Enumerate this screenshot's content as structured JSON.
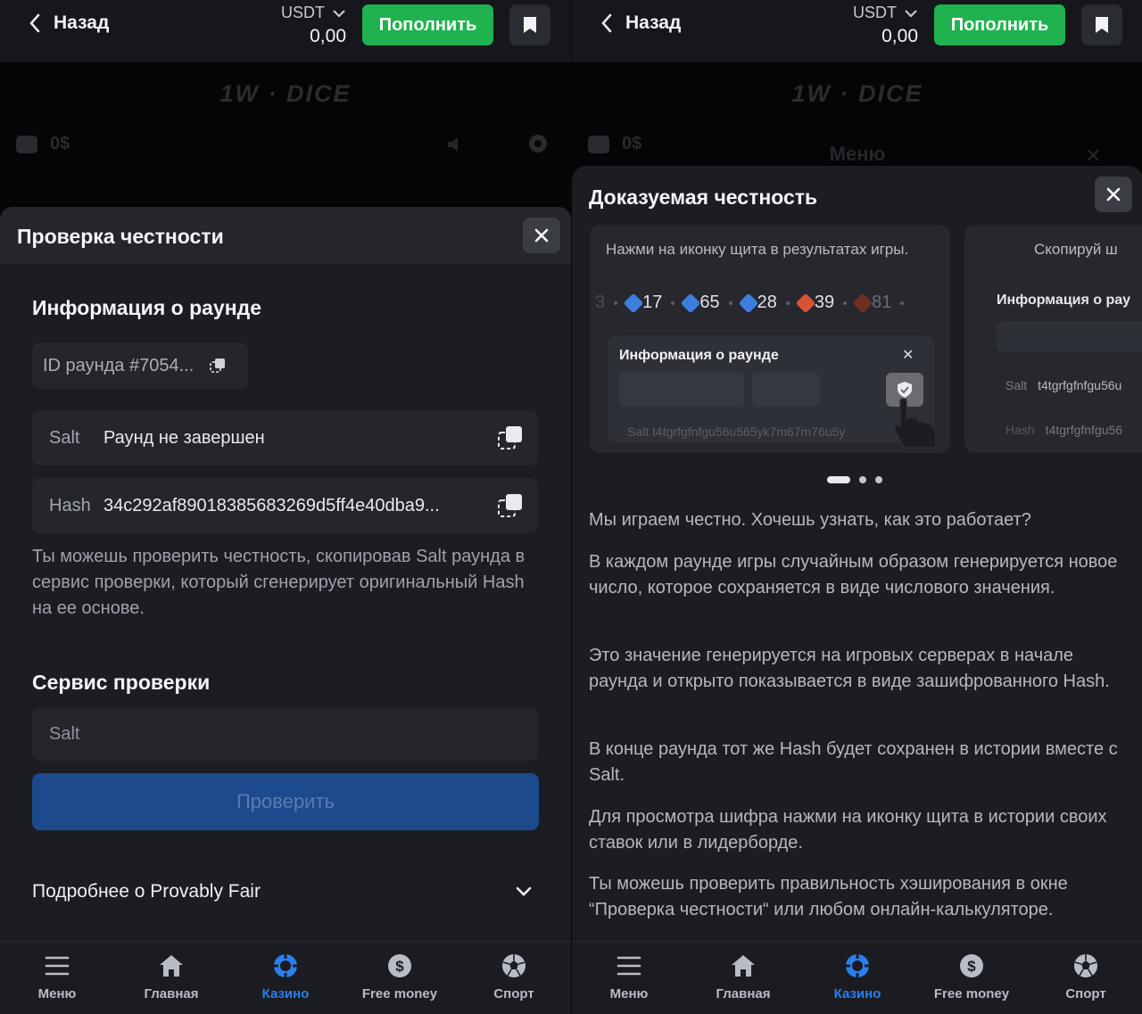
{
  "topbar": {
    "back_label": "Назад",
    "currency": "USDT",
    "balance": "0,00",
    "deposit_label": "Пополнить"
  },
  "game": {
    "logo": "1W · DICE",
    "wallet_amount": "0$",
    "menu_label": "Меню"
  },
  "fairness_check": {
    "title": "Проверка честности",
    "round_info_title": "Информация о раунде",
    "round_id": "ID раунда #7054...",
    "salt_label": "Salt",
    "salt_value": "Раунд не завершен",
    "hash_label": "Hash",
    "hash_value": "34c292af89018385683269d5ff4e40dba9...",
    "help_text": "Ты можешь проверить честность, скопировав Salt раунда в сервис проверки, который сгенерирует оригинальный Hash на ее основе.",
    "service_title": "Сервис проверки",
    "salt_placeholder": "Salt",
    "check_button": "Проверить",
    "more_label": "Подробнее о Provably Fair"
  },
  "provable": {
    "title": "Доказуемая честность",
    "slide1": {
      "caption": "Нажми на иконку щита в результатах игры.",
      "dice": [
        {
          "value": "17",
          "color": "blue"
        },
        {
          "value": "65",
          "color": "blue"
        },
        {
          "value": "28",
          "color": "blue"
        },
        {
          "value": "39",
          "color": "red"
        },
        {
          "value": "81",
          "color": "dim"
        }
      ],
      "ghost_left": "3",
      "card_title": "Информация о раунде",
      "card_salt": "Salt t4tgrfgfnfgu56u565yk7m67m76u5y"
    },
    "slide2": {
      "caption": "Скопируй ш",
      "card_title": "Информация о рау",
      "salt_label": "Salt",
      "salt_value": "t4tgrfgfnfgu56u",
      "hash_label": "Hash",
      "hash_value": "t4tgrfgfnfgu56"
    },
    "paragraphs": [
      "Мы играем честно. Хочешь узнать, как это работает?",
      "В каждом раунде игры случайным образом генерируется новое число, которое сохраняется в виде числового значения.",
      "Это значение генерируется на игровых серверах в начале раунда и открыто показывается в виде зашифрованного Hash.",
      "В конце раунда тот же Hash будет сохранен в истории вместе с Salt.",
      "Для просмотра шифра нажми на иконку щита в истории своих ставок или в лидерборде.",
      "Ты можешь проверить правильность хэширования в окне “Проверка честности“ или любом онлайн-калькуляторе."
    ]
  },
  "bottom_nav": [
    {
      "label": "Меню",
      "icon": "menu-icon"
    },
    {
      "label": "Главная",
      "icon": "home-icon"
    },
    {
      "label": "Казино",
      "icon": "casino-chip-icon",
      "active": true
    },
    {
      "label": "Free money",
      "icon": "dollar-icon"
    },
    {
      "label": "Спорт",
      "icon": "soccer-ball-icon"
    }
  ],
  "colors": {
    "accent_green": "#20b24f",
    "accent_blue": "#2a7ff0",
    "check_button": "#1c4a8d"
  }
}
